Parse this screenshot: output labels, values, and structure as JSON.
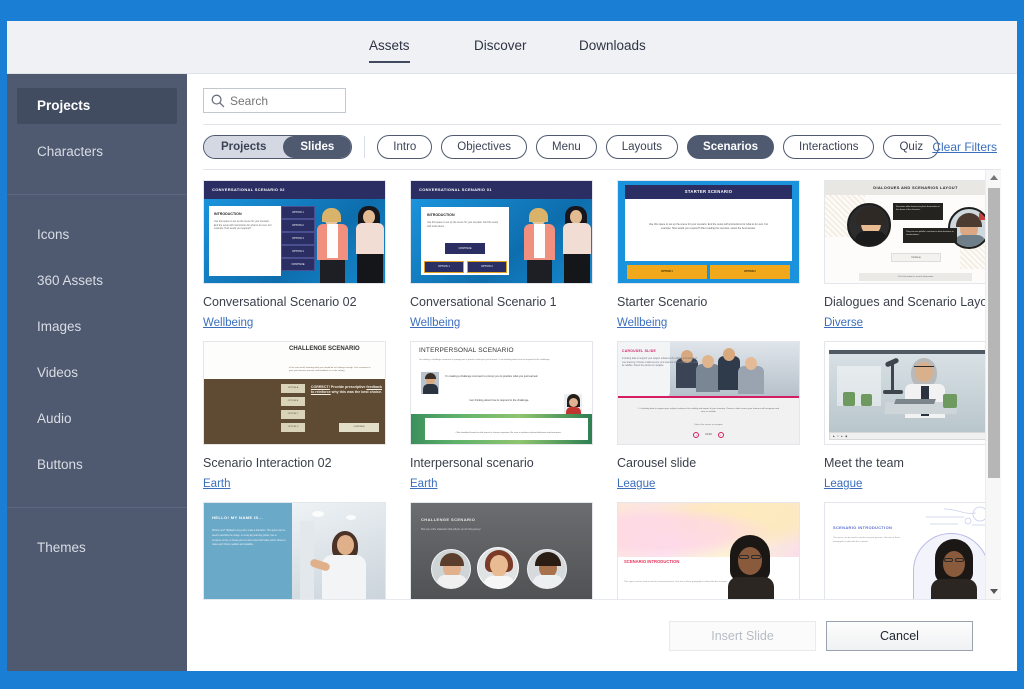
{
  "window": {
    "accent_color": "#1a7ed4",
    "sidebar_color": "#4f5a70"
  },
  "header": {
    "tabs": [
      {
        "label": "Assets",
        "active": true
      },
      {
        "label": "Discover",
        "active": false
      },
      {
        "label": "Downloads",
        "active": false
      }
    ]
  },
  "sidebar": {
    "group1": [
      {
        "label": "Projects",
        "selected": true
      },
      {
        "label": "Characters",
        "selected": false
      }
    ],
    "group2": [
      {
        "label": "Icons",
        "selected": false
      },
      {
        "label": "360 Assets",
        "selected": false
      },
      {
        "label": "Images",
        "selected": false
      },
      {
        "label": "Videos",
        "selected": false
      },
      {
        "label": "Audio",
        "selected": false
      },
      {
        "label": "Buttons",
        "selected": false
      }
    ],
    "group3": [
      {
        "label": "Themes",
        "selected": false
      }
    ]
  },
  "search": {
    "value": "",
    "placeholder": "Search",
    "icon": "search-icon"
  },
  "filters": {
    "toggle": {
      "left_label": "Projects",
      "right_label": "Slides",
      "selected": "Slides"
    },
    "pills": [
      {
        "label": "Intro",
        "active": false
      },
      {
        "label": "Objectives",
        "active": false
      },
      {
        "label": "Menu",
        "active": false
      },
      {
        "label": "Layouts",
        "active": false
      },
      {
        "label": "Scenarios",
        "active": true
      },
      {
        "label": "Interactions",
        "active": false
      },
      {
        "label": "Quiz",
        "active": false
      }
    ],
    "clear_label": "Clear Filters"
  },
  "grid": {
    "rows": [
      [
        {
          "title": "Conversational Scenario 02",
          "theme": "Wellbeing",
          "slide_heading": "CONVERSATIONAL SCENARIO 02",
          "slide_body_title": "INTRODUCTION",
          "slide_body_text": "Use this space to set up the scene for your scenario. End the setup with instructions for what to do next. For example: How would you respond?",
          "options": [
            "OPTION 1",
            "OPTION 2",
            "OPTION 3",
            "OPTION 4",
            "CONTINUE"
          ],
          "art": "conv02"
        },
        {
          "title": "Conversational Scenario 1",
          "theme": "Wellbeing",
          "slide_heading": "CONVERSATIONAL SCENARIO 01",
          "slide_body_title": "INTRODUCTION",
          "slide_body_text": "Use this space to set up the scene for your scenario. End the setup with instructions.",
          "options": [
            "CONTINUE",
            "OPTION 1",
            "OPTION 2"
          ],
          "art": "conv01"
        },
        {
          "title": "Starter Scenario",
          "theme": "Wellbeing",
          "slide_heading": "STARTER SCENARIO",
          "slide_body_title": "",
          "slide_body_text": "Use this space to set up the scene for your scenario. End the setup with instructions for what to do next. For example: How would you respond? After reading the scenario, select the best answer.",
          "options": [
            "OPTION 1",
            "OPTION 2"
          ],
          "art": "starter"
        },
        {
          "title": "Dialogues and Scenario Layout",
          "theme": "Diverse",
          "slide_heading": "DIALOGUES AND SCENARIOS LAYOUT",
          "slide_body_title": "",
          "slide_body_text": "Click the button to reveal information",
          "options": [
            "Continue"
          ],
          "art": "dialogues"
        }
      ],
      [
        {
          "title": "Scenario Interaction 02",
          "theme": "Earth",
          "slide_heading": "CHALLENGE SCENARIO",
          "slide_body_title": "",
          "slide_body_text": "In the real world, knowing what you should do isn't always enough. Use scenarios to give your learners practice and feedback in a safe setting.",
          "options": [
            "OPTION A",
            "OPTION B",
            "OPTION C",
            "OPTION D",
            "CONTINUE"
          ],
          "art": "challenge"
        },
        {
          "title": "Interpersonal scenario",
          "theme": "Earth",
          "slide_heading": "INTERPERSONAL SCENARIO",
          "slide_body_title": "",
          "slide_body_text": "I'm making a challenge comment to prompt you to practice what you just learned. / I am thinking about how to respond to the challenge.",
          "options": [],
          "art": "interpersonal"
        },
        {
          "title": "Carousel slide",
          "theme": "League",
          "slide_heading": "CAROUSEL SLIDE",
          "slide_body_title": "",
          "slide_body_text": "Including data to support your subject enhances the validity and impact of your learning. Choose a data source your learners will recognize and view as reliable. Select the arrows to navigate.",
          "options": [
            "01/03"
          ],
          "art": "carousel"
        },
        {
          "title": "Meet the team",
          "theme": "League",
          "slide_heading": "",
          "slide_body_title": "",
          "slide_body_text": "",
          "options": [],
          "art": "meetteam"
        }
      ],
      [
        {
          "title": "",
          "theme": "",
          "slide_heading": "HELLO! MY NAME IS...",
          "slide_body_title": "",
          "slide_body_text": "What's next? Highlight a key point, make a transition. This space can be used to describe the image, or recap key learning points. Use a sentence or two, or break your text into a few brief bullet points. Strive to make each choice realistic and relatable.",
          "options": [],
          "art": "hello"
        },
        {
          "title": "",
          "theme": "",
          "slide_heading": "CHALLENGE SCENARIO",
          "slide_body_title": "",
          "slide_body_text": "Pick one of the characters that will join you for this journey!",
          "options": [],
          "art": "charpick"
        },
        {
          "title": "",
          "theme": "",
          "slide_heading": "SCENARIO INTRODUCTION",
          "slide_body_title": "",
          "slide_body_text": "This space can be used to set the scenario premise. Use two or three paragraphs to describe the scenario.",
          "options": [],
          "art": "scenintro1"
        },
        {
          "title": "",
          "theme": "",
          "slide_heading": "SCENARIO INTRODUCTION",
          "slide_body_title": "",
          "slide_body_text": "The space can be used to set the scenario premise. Use two or three paragraphs to describe the scenario.",
          "options": [],
          "art": "scenintro2"
        }
      ]
    ]
  },
  "scrollbar": {
    "up_icon": "chevron-up-icon",
    "down_icon": "chevron-down-icon",
    "position_percent": 4
  },
  "footer": {
    "insert_label": "Insert Slide",
    "insert_enabled": false,
    "cancel_label": "Cancel"
  }
}
